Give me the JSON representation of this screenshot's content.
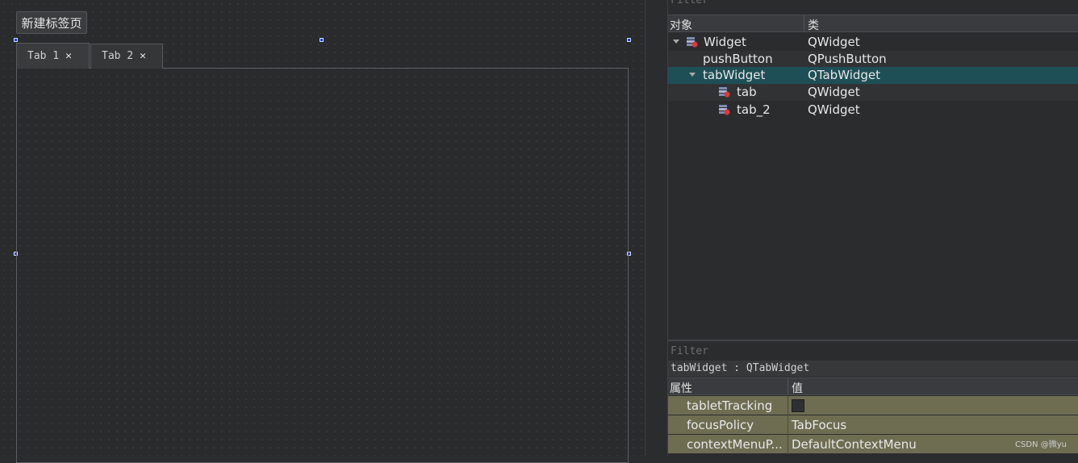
{
  "designer": {
    "new_tab_button": "新建标签页",
    "tabs": [
      {
        "label": "Tab 1",
        "active": true
      },
      {
        "label": "Tab 2",
        "active": false
      }
    ]
  },
  "object_inspector": {
    "filter_label": "Filter",
    "columns": [
      "对象",
      "类"
    ],
    "rows": [
      {
        "name": "Widget",
        "class": "QWidget",
        "expanded": true,
        "icon": "widget-icon"
      },
      {
        "name": "pushButton",
        "class": "QPushButton"
      },
      {
        "name": "tabWidget",
        "class": "QTabWidget",
        "expanded": true,
        "selected": true
      },
      {
        "name": "tab",
        "class": "QWidget",
        "icon": "widget-icon"
      },
      {
        "name": "tab_2",
        "class": "QWidget",
        "icon": "widget-icon"
      }
    ]
  },
  "property_editor": {
    "filter_label": "Filter",
    "class_line": "tabWidget : QTabWidget",
    "columns": [
      "属性",
      "值"
    ],
    "rows": [
      {
        "name": "tabletTracking",
        "value": "",
        "checkbox": true
      },
      {
        "name": "focusPolicy",
        "value": "TabFocus"
      },
      {
        "name": "contextMenuP...",
        "value": "DefaultContextMenu"
      }
    ]
  },
  "watermark": "CSDN @微yu",
  "colors": {
    "selection_row": "#1f4f56",
    "property_row": "#6e6d52",
    "handle": "#1f3cff"
  }
}
